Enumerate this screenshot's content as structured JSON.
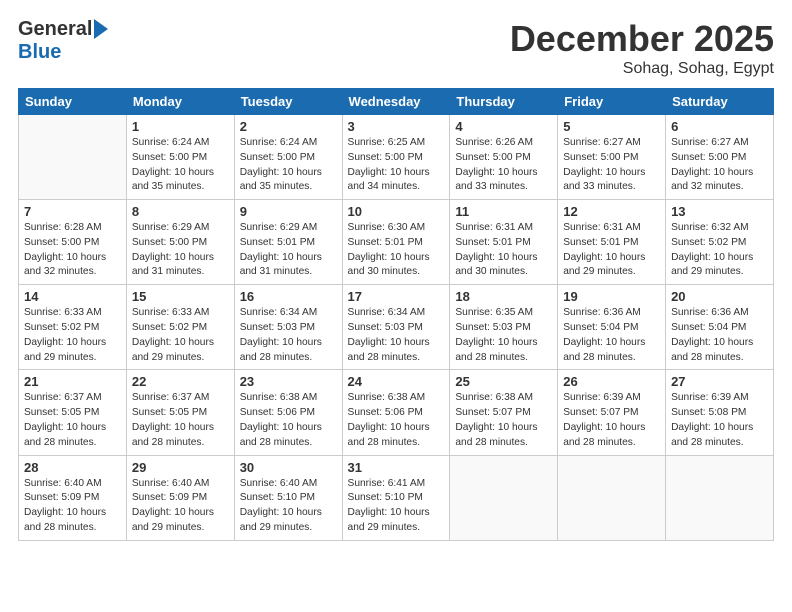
{
  "logo": {
    "general": "General",
    "blue": "Blue"
  },
  "header": {
    "month": "December 2025",
    "location": "Sohag, Sohag, Egypt"
  },
  "weekdays": [
    "Sunday",
    "Monday",
    "Tuesday",
    "Wednesday",
    "Thursday",
    "Friday",
    "Saturday"
  ],
  "weeks": [
    [
      {
        "day": "",
        "info": ""
      },
      {
        "day": "1",
        "info": "Sunrise: 6:24 AM\nSunset: 5:00 PM\nDaylight: 10 hours\nand 35 minutes."
      },
      {
        "day": "2",
        "info": "Sunrise: 6:24 AM\nSunset: 5:00 PM\nDaylight: 10 hours\nand 35 minutes."
      },
      {
        "day": "3",
        "info": "Sunrise: 6:25 AM\nSunset: 5:00 PM\nDaylight: 10 hours\nand 34 minutes."
      },
      {
        "day": "4",
        "info": "Sunrise: 6:26 AM\nSunset: 5:00 PM\nDaylight: 10 hours\nand 33 minutes."
      },
      {
        "day": "5",
        "info": "Sunrise: 6:27 AM\nSunset: 5:00 PM\nDaylight: 10 hours\nand 33 minutes."
      },
      {
        "day": "6",
        "info": "Sunrise: 6:27 AM\nSunset: 5:00 PM\nDaylight: 10 hours\nand 32 minutes."
      }
    ],
    [
      {
        "day": "7",
        "info": "Sunrise: 6:28 AM\nSunset: 5:00 PM\nDaylight: 10 hours\nand 32 minutes."
      },
      {
        "day": "8",
        "info": "Sunrise: 6:29 AM\nSunset: 5:00 PM\nDaylight: 10 hours\nand 31 minutes."
      },
      {
        "day": "9",
        "info": "Sunrise: 6:29 AM\nSunset: 5:01 PM\nDaylight: 10 hours\nand 31 minutes."
      },
      {
        "day": "10",
        "info": "Sunrise: 6:30 AM\nSunset: 5:01 PM\nDaylight: 10 hours\nand 30 minutes."
      },
      {
        "day": "11",
        "info": "Sunrise: 6:31 AM\nSunset: 5:01 PM\nDaylight: 10 hours\nand 30 minutes."
      },
      {
        "day": "12",
        "info": "Sunrise: 6:31 AM\nSunset: 5:01 PM\nDaylight: 10 hours\nand 29 minutes."
      },
      {
        "day": "13",
        "info": "Sunrise: 6:32 AM\nSunset: 5:02 PM\nDaylight: 10 hours\nand 29 minutes."
      }
    ],
    [
      {
        "day": "14",
        "info": "Sunrise: 6:33 AM\nSunset: 5:02 PM\nDaylight: 10 hours\nand 29 minutes."
      },
      {
        "day": "15",
        "info": "Sunrise: 6:33 AM\nSunset: 5:02 PM\nDaylight: 10 hours\nand 29 minutes."
      },
      {
        "day": "16",
        "info": "Sunrise: 6:34 AM\nSunset: 5:03 PM\nDaylight: 10 hours\nand 28 minutes."
      },
      {
        "day": "17",
        "info": "Sunrise: 6:34 AM\nSunset: 5:03 PM\nDaylight: 10 hours\nand 28 minutes."
      },
      {
        "day": "18",
        "info": "Sunrise: 6:35 AM\nSunset: 5:03 PM\nDaylight: 10 hours\nand 28 minutes."
      },
      {
        "day": "19",
        "info": "Sunrise: 6:36 AM\nSunset: 5:04 PM\nDaylight: 10 hours\nand 28 minutes."
      },
      {
        "day": "20",
        "info": "Sunrise: 6:36 AM\nSunset: 5:04 PM\nDaylight: 10 hours\nand 28 minutes."
      }
    ],
    [
      {
        "day": "21",
        "info": "Sunrise: 6:37 AM\nSunset: 5:05 PM\nDaylight: 10 hours\nand 28 minutes."
      },
      {
        "day": "22",
        "info": "Sunrise: 6:37 AM\nSunset: 5:05 PM\nDaylight: 10 hours\nand 28 minutes."
      },
      {
        "day": "23",
        "info": "Sunrise: 6:38 AM\nSunset: 5:06 PM\nDaylight: 10 hours\nand 28 minutes."
      },
      {
        "day": "24",
        "info": "Sunrise: 6:38 AM\nSunset: 5:06 PM\nDaylight: 10 hours\nand 28 minutes."
      },
      {
        "day": "25",
        "info": "Sunrise: 6:38 AM\nSunset: 5:07 PM\nDaylight: 10 hours\nand 28 minutes."
      },
      {
        "day": "26",
        "info": "Sunrise: 6:39 AM\nSunset: 5:07 PM\nDaylight: 10 hours\nand 28 minutes."
      },
      {
        "day": "27",
        "info": "Sunrise: 6:39 AM\nSunset: 5:08 PM\nDaylight: 10 hours\nand 28 minutes."
      }
    ],
    [
      {
        "day": "28",
        "info": "Sunrise: 6:40 AM\nSunset: 5:09 PM\nDaylight: 10 hours\nand 28 minutes."
      },
      {
        "day": "29",
        "info": "Sunrise: 6:40 AM\nSunset: 5:09 PM\nDaylight: 10 hours\nand 29 minutes."
      },
      {
        "day": "30",
        "info": "Sunrise: 6:40 AM\nSunset: 5:10 PM\nDaylight: 10 hours\nand 29 minutes."
      },
      {
        "day": "31",
        "info": "Sunrise: 6:41 AM\nSunset: 5:10 PM\nDaylight: 10 hours\nand 29 minutes."
      },
      {
        "day": "",
        "info": ""
      },
      {
        "day": "",
        "info": ""
      },
      {
        "day": "",
        "info": ""
      }
    ]
  ]
}
